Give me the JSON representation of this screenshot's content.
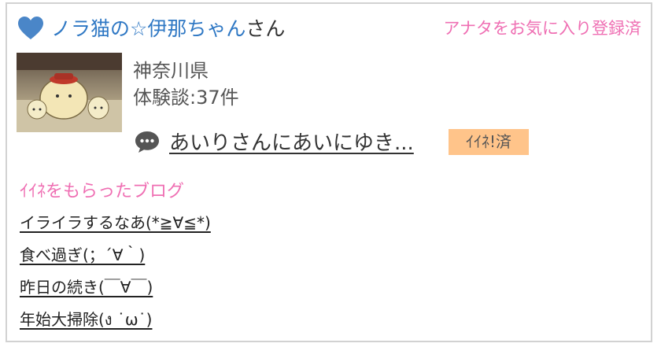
{
  "header": {
    "user_name": "ノラ猫の☆伊那ちゃん",
    "honorific": "さん",
    "favorite_status": "アナタをお気に入り登録済",
    "heart_color": "#4a86c8"
  },
  "profile": {
    "prefecture": "神奈川県",
    "experience_count": "体験談:37件"
  },
  "latest": {
    "title": "あいりさんにあいにゆき...",
    "iine_badge": "ｲｲﾈ!済"
  },
  "liked_blogs": {
    "heading": "ｲｲﾈをもらったブログ",
    "items": [
      {
        "title": "イライラするなあ(*≧∀≦*)"
      },
      {
        "title": "食べ過ぎ(；´∀｀)"
      },
      {
        "title": "昨日の続き(￣∀￣)"
      },
      {
        "title": "年始大掃除(ง ˙ω˙)"
      }
    ]
  },
  "colors": {
    "accent_pink": "#ef6fb3",
    "user_blue": "#2f78c4",
    "badge_orange": "#ffc48a"
  }
}
